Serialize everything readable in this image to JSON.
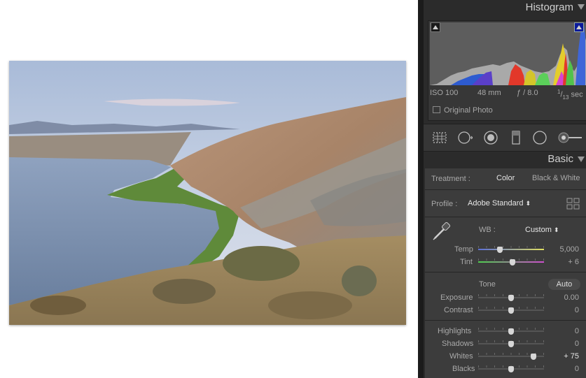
{
  "histogram": {
    "title": "Histogram",
    "iso": "ISO 100",
    "focal": "48 mm",
    "aperture": "ƒ / 8.0",
    "shutter_num": "1",
    "shutter_den": "13",
    "shutter_unit": "sec",
    "original_photo_label": "Original Photo"
  },
  "tools": [
    "crop-overlay",
    "spot-removal",
    "red-eye",
    "graduated-filter",
    "radial-filter",
    "adjustment-brush"
  ],
  "basic": {
    "title": "Basic",
    "treatment_label": "Treatment :",
    "treatment_color": "Color",
    "treatment_bw": "Black & White",
    "profile_label": "Profile :",
    "profile_value": "Adobe Standard",
    "wb_label": "WB :",
    "wb_value": "Custom",
    "tone_label": "Tone",
    "auto_label": "Auto",
    "sliders": [
      {
        "key": "temp",
        "label": "Temp",
        "value": "5,000",
        "pos": 0.33
      },
      {
        "key": "tint",
        "label": "Tint",
        "value": "+ 6",
        "pos": 0.52
      },
      {
        "key": "exposure",
        "label": "Exposure",
        "value": "0.00",
        "pos": 0.5
      },
      {
        "key": "contrast",
        "label": "Contrast",
        "value": "0",
        "pos": 0.5
      },
      {
        "key": "highlights",
        "label": "Highlights",
        "value": "0",
        "pos": 0.5
      },
      {
        "key": "shadows",
        "label": "Shadows",
        "value": "0",
        "pos": 0.5
      },
      {
        "key": "whites",
        "label": "Whites",
        "value": "+ 75",
        "pos": 0.84
      },
      {
        "key": "blacks",
        "label": "Blacks",
        "value": "0",
        "pos": 0.5
      }
    ]
  },
  "colors": {
    "panel_bg": "#2b2b2b",
    "temp_gradient": [
      "#5b6fd8",
      "#e0e060"
    ],
    "tint_gradient": [
      "#4fcf4f",
      "#cf4fcf"
    ]
  }
}
